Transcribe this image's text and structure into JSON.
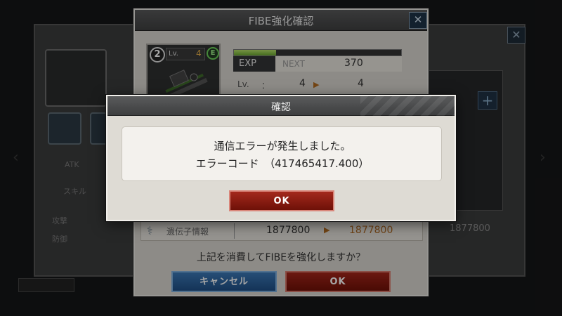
{
  "background": {
    "stats": [
      "ATK",
      "スキル",
      "攻撃",
      "防御"
    ],
    "gene_value": "1877800"
  },
  "confirm_dialog": {
    "title": "FIBE強化確認",
    "close_label": "✕",
    "card": {
      "rank": "2",
      "lv_label": "Lv.",
      "lv_value": "4",
      "element": "E"
    },
    "exp": {
      "label": "EXP",
      "next_label": "NEXT",
      "next_value": "370",
      "progress": 0.25
    },
    "level": {
      "label": "Lv.",
      "colon": "：",
      "current": "4",
      "after": "4"
    },
    "gene": {
      "label": "遺伝子情報",
      "current": "1877800",
      "after": "1877800"
    },
    "question": "上記を消費してFIBEを強化しますか？",
    "cancel_label": "キャンセル",
    "ok_label": "OK"
  },
  "error_dialog": {
    "title": "確認",
    "message_line1": "通信エラーが発生しました。",
    "message_line2": "エラーコード　（417465417.400）",
    "ok_label": "OK"
  },
  "colors": {
    "ok_red": "#8b1a10",
    "cancel_blue": "#2a5f98",
    "exp_green": "#8cc84b",
    "accent_orange": "#b36a1f"
  }
}
